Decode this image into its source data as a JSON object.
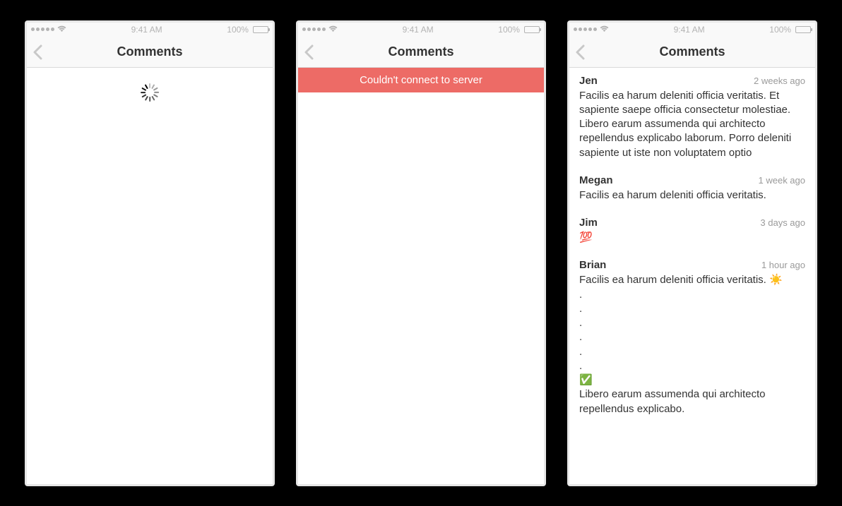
{
  "statusbar": {
    "time": "9:41 AM",
    "battery": "100%"
  },
  "nav": {
    "title": "Comments"
  },
  "error": {
    "message": "Couldn't connect to server"
  },
  "comments": [
    {
      "author": "Jen",
      "time": "2 weeks ago",
      "body": "Facilis ea harum deleniti officia veritatis. Et sapiente saepe officia consectetur molestiae. Libero earum assumenda qui architecto repellendus explicabo laborum. Porro deleniti sapiente ut iste non voluptatem optio"
    },
    {
      "author": "Megan",
      "time": "1 week ago",
      "body": "Facilis ea harum deleniti officia veritatis."
    },
    {
      "author": "Jim",
      "time": "3 days ago",
      "body": "💯"
    },
    {
      "author": "Brian",
      "time": "1 hour ago",
      "body": "Facilis ea harum deleniti officia veritatis. ☀️\n.\n.\n.\n.\n.\n.\n✅\nLibero earum assumenda qui architecto repellendus explicabo."
    }
  ]
}
